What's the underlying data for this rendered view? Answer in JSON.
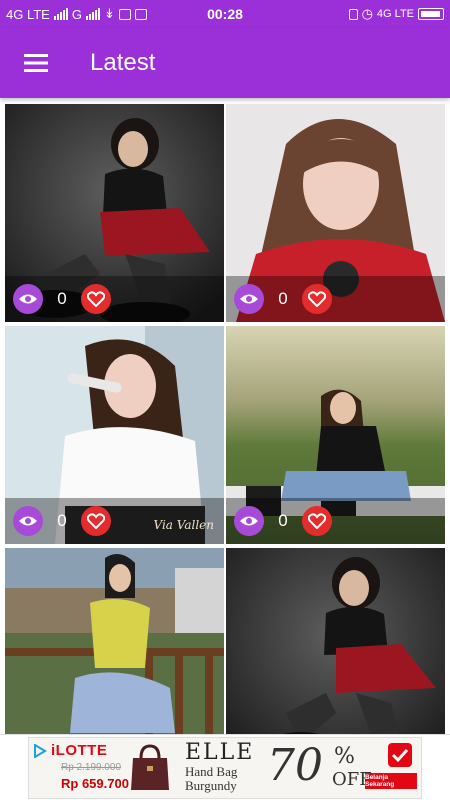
{
  "status_bar": {
    "left_text": "4G LTE",
    "carrier_g": "G",
    "time": "00:28",
    "right_text": "4G LTE"
  },
  "app_bar": {
    "title": "Latest",
    "menu_icon": "hamburger-menu-icon"
  },
  "cards": [
    {
      "views": "0",
      "watermark": ""
    },
    {
      "views": "0",
      "watermark": ""
    },
    {
      "views": "0",
      "watermark": "Via Vallen"
    },
    {
      "views": "0",
      "watermark": ""
    },
    {
      "views": "",
      "watermark": ""
    },
    {
      "views": "",
      "watermark": ""
    }
  ],
  "ad": {
    "brand": "iLOTTE",
    "old_price": "Rp 2.199.000",
    "price": "Rp 659.700",
    "headline": "ELLE",
    "desc_line1": "Hand Bag",
    "desc_line2": "Burgundy",
    "discount": "70",
    "percent_sign": "%",
    "off_text": "OFF",
    "cta": "Belanja Sekarang"
  },
  "colors": {
    "primary": "#9b30d9",
    "view_button": "#a84ad8",
    "like_button": "#e52c2c"
  }
}
